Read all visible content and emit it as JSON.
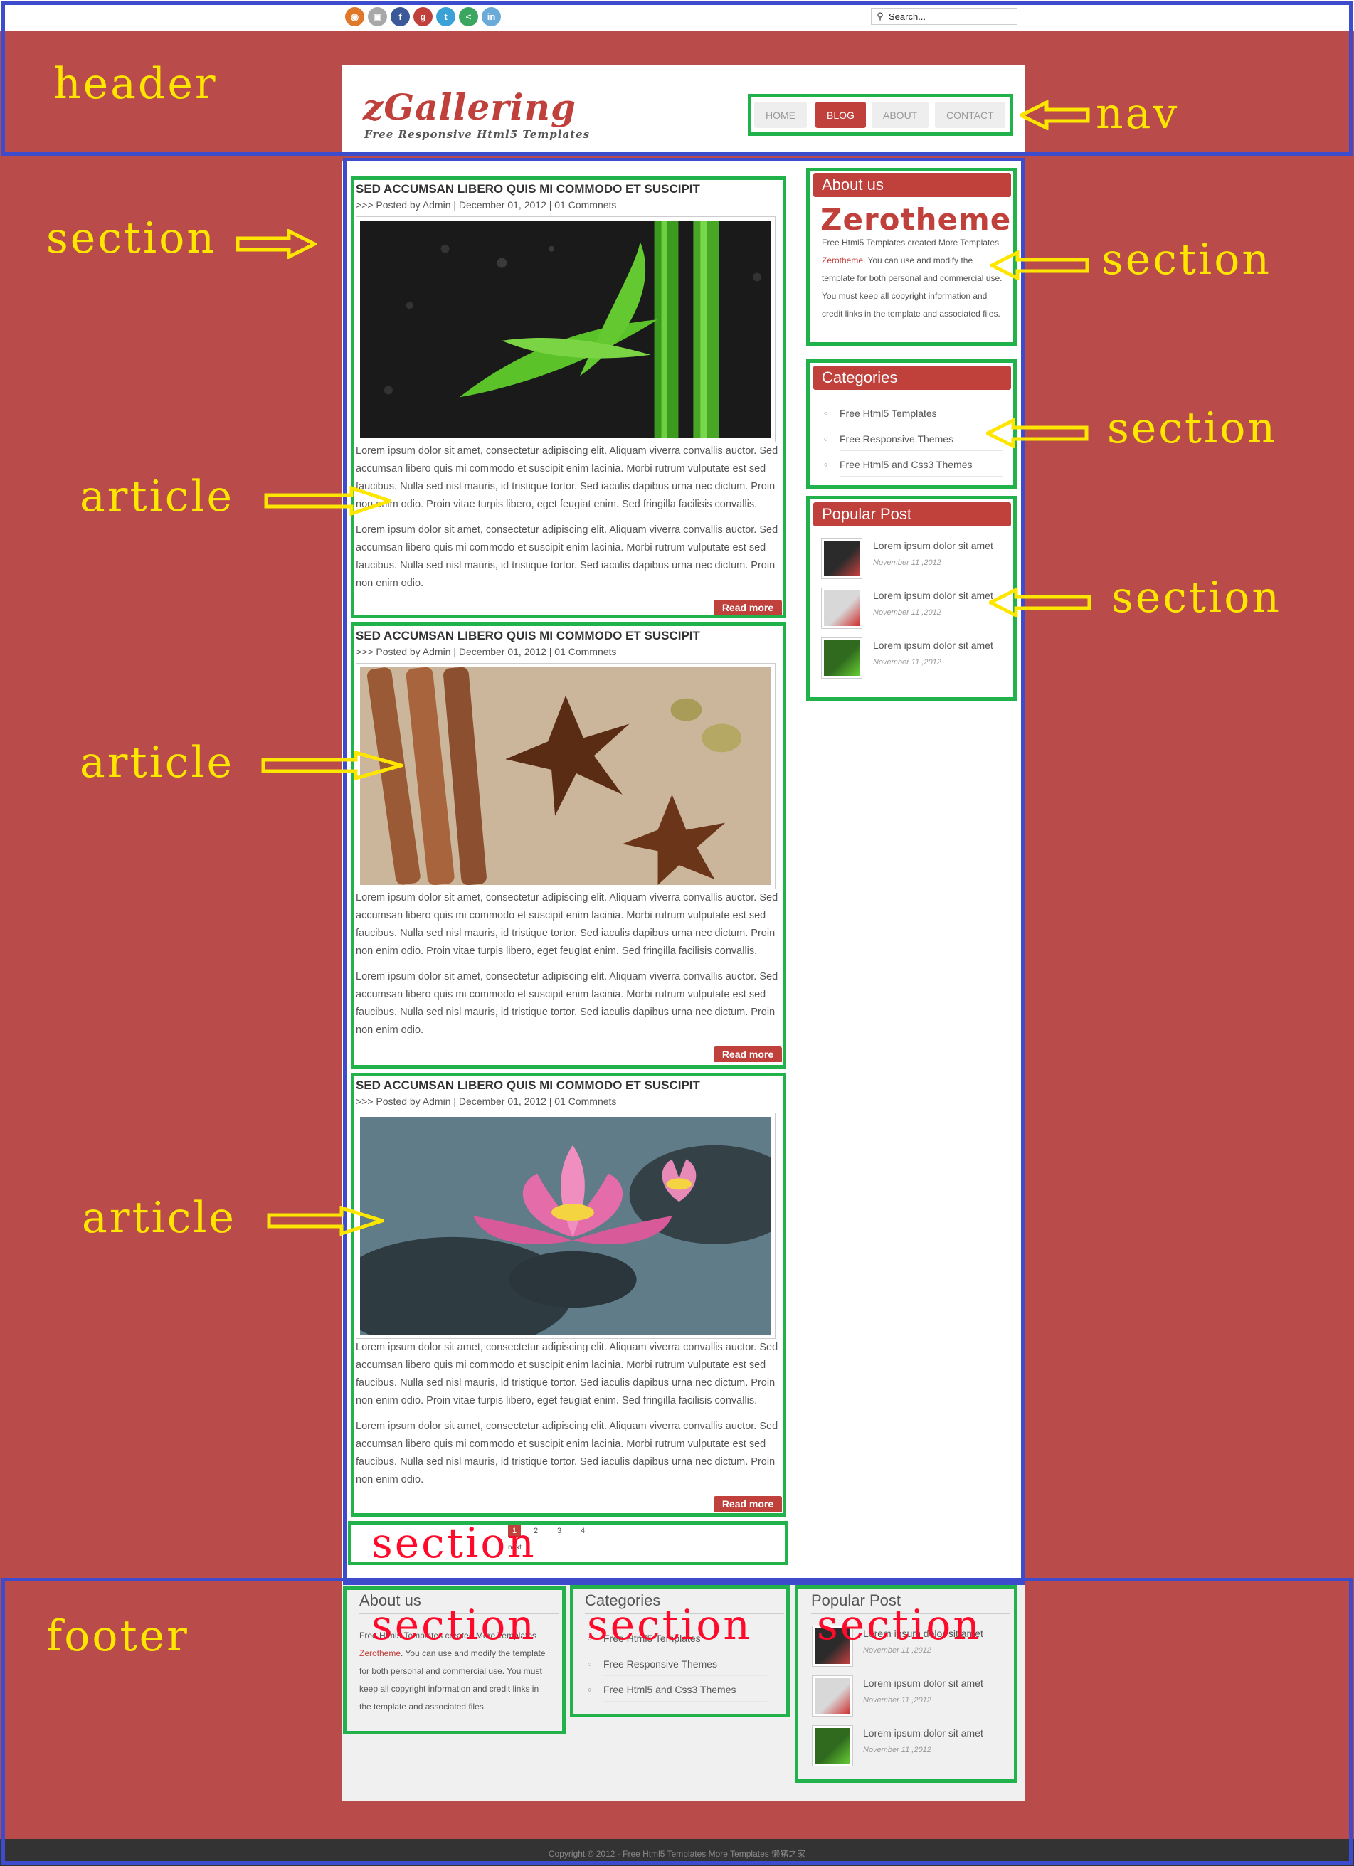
{
  "social_icons": [
    {
      "name": "rss-icon",
      "glyph": "◉",
      "color": "#e0782a"
    },
    {
      "name": "delicious-icon",
      "glyph": "▣",
      "color": "#a8a8a8"
    },
    {
      "name": "facebook-icon",
      "glyph": "f",
      "color": "#3b5998"
    },
    {
      "name": "google-plus-icon",
      "glyph": "g",
      "color": "#c0403c"
    },
    {
      "name": "twitter-icon",
      "glyph": "t",
      "color": "#3aa2d6"
    },
    {
      "name": "share-icon",
      "glyph": "<",
      "color": "#3aa660"
    },
    {
      "name": "linkedin-icon",
      "glyph": "in",
      "color": "#6aaad8"
    }
  ],
  "search": {
    "placeholder": "Search..."
  },
  "logo": {
    "title": "zGallering",
    "tagline": "Free Responsive Html5 Templates"
  },
  "nav": [
    {
      "label": "HOME",
      "active": false
    },
    {
      "label": "BLOG",
      "active": true
    },
    {
      "label": "ABOUT",
      "active": false
    },
    {
      "label": "CONTACT",
      "active": false
    }
  ],
  "annotations": {
    "header": "header",
    "nav": "nav",
    "section": "section",
    "article": "article",
    "footer": "footer"
  },
  "articles": [
    {
      "title": "SED ACCUMSAN LIBERO QUIS MI COMMODO ET SUSCIPIT",
      "meta": ">>> Posted by Admin | December 01, 2012 | 01 Commnets",
      "image": "bamboo",
      "p1": "Lorem ipsum dolor sit amet, consectetur adipiscing elit. Aliquam viverra convallis auctor. Sed accumsan libero quis mi commodo et suscipit enim lacinia. Morbi rutrum vulputate est sed faucibus. Nulla sed nisl mauris, id tristique tortor. Sed iaculis dapibus urna nec dictum. Proin non enim odio. Proin vitae turpis libero, eget feugiat enim. Sed fringilla facilisis convallis.",
      "p2": "Lorem ipsum dolor sit amet, consectetur adipiscing elit. Aliquam viverra convallis auctor. Sed accumsan libero quis mi commodo et suscipit enim lacinia. Morbi rutrum vulputate est sed faucibus. Nulla sed nisl mauris, id tristique tortor. Sed iaculis dapibus urna nec dictum. Proin non enim odio.",
      "read_more": "Read more"
    },
    {
      "title": "SED ACCUMSAN LIBERO QUIS MI COMMODO ET SUSCIPIT",
      "meta": ">>> Posted by Admin | December 01, 2012 | 01 Commnets",
      "image": "spices",
      "p1": "Lorem ipsum dolor sit amet, consectetur adipiscing elit. Aliquam viverra convallis auctor. Sed accumsan libero quis mi commodo et suscipit enim lacinia. Morbi rutrum vulputate est sed faucibus. Nulla sed nisl mauris, id tristique tortor. Sed iaculis dapibus urna nec dictum. Proin non enim odio. Proin vitae turpis libero, eget feugiat enim. Sed fringilla facilisis convallis.",
      "p2": "Lorem ipsum dolor sit amet, consectetur adipiscing elit. Aliquam viverra convallis auctor. Sed accumsan libero quis mi commodo et suscipit enim lacinia. Morbi rutrum vulputate est sed faucibus. Nulla sed nisl mauris, id tristique tortor. Sed iaculis dapibus urna nec dictum. Proin non enim odio.",
      "read_more": "Read more"
    },
    {
      "title": "SED ACCUMSAN LIBERO QUIS MI COMMODO ET SUSCIPIT",
      "meta": ">>> Posted by Admin | December 01, 2012 | 01 Commnets",
      "image": "lotus",
      "p1": "Lorem ipsum dolor sit amet, consectetur adipiscing elit. Aliquam viverra convallis auctor. Sed accumsan libero quis mi commodo et suscipit enim lacinia. Morbi rutrum vulputate est sed faucibus. Nulla sed nisl mauris, id tristique tortor. Sed iaculis dapibus urna nec dictum. Proin non enim odio. Proin vitae turpis libero, eget feugiat enim. Sed fringilla facilisis convallis.",
      "p2": "Lorem ipsum dolor sit amet, consectetur adipiscing elit. Aliquam viverra convallis auctor. Sed accumsan libero quis mi commodo et suscipit enim lacinia. Morbi rutrum vulputate est sed faucibus. Nulla sed nisl mauris, id tristique tortor. Sed iaculis dapibus urna nec dictum. Proin non enim odio.",
      "read_more": "Read more"
    }
  ],
  "sidebar": {
    "about": {
      "title": "About us",
      "brand": "Zerotheme",
      "subline": "Free Html5 Templates created More Templates",
      "link": "Zerotheme",
      "text": ". You can use and modify the template for both personal and commercial use. You must keep all copyright information and credit links in the template and associated files."
    },
    "categories": {
      "title": "Categories",
      "items": [
        "Free Html5 Templates",
        "Free Responsive Themes",
        "Free Html5 and Css3 Themes"
      ]
    },
    "popular": {
      "title": "Popular Post",
      "items": [
        {
          "title": "Lorem ipsum dolor sit amet",
          "date": "November 11 ,2012",
          "thumb": "dark"
        },
        {
          "title": "Lorem ipsum dolor sit amet",
          "date": "November 11 ,2012",
          "thumb": "red"
        },
        {
          "title": "Lorem ipsum dolor sit amet",
          "date": "November 11 ,2012",
          "thumb": "bamboo"
        }
      ]
    }
  },
  "pagination": {
    "pages": [
      "1",
      "2",
      "3",
      "4"
    ],
    "current": "1",
    "next": "next"
  },
  "footer": {
    "about": {
      "title": "About us",
      "subline": "Free Html5 Templates created More Templates",
      "link": "Zerotheme",
      "text": ". You can use and modify the template for both personal and commercial use. You must keep all copyright information and credit links in the template and associated files."
    },
    "categories": {
      "title": "Categories",
      "items": [
        "Free Html5 Templates",
        "Free Responsive Themes",
        "Free Html5 and Css3 Themes"
      ]
    },
    "popular": {
      "title": "Popular Post",
      "items": [
        {
          "title": "Lorem ipsum dolor sit amet",
          "date": "November 11 ,2012"
        },
        {
          "title": "Lorem ipsum dolor sit amet",
          "date": "November 11 ,2012"
        },
        {
          "title": "Lorem ipsum dolor sit amet",
          "date": "November 11 ,2012"
        }
      ]
    }
  },
  "copyright": "Copyright © 2012 - Free Html5 Templates More Templates 懒猪之家",
  "colors": {
    "accent": "#c0403c",
    "page_bg": "#b94b4b",
    "annotation_blue": "#3c4ccc",
    "annotation_green": "#22b24c",
    "annotation_yellow": "#ffe600",
    "annotation_red": "#ff0a2a"
  }
}
